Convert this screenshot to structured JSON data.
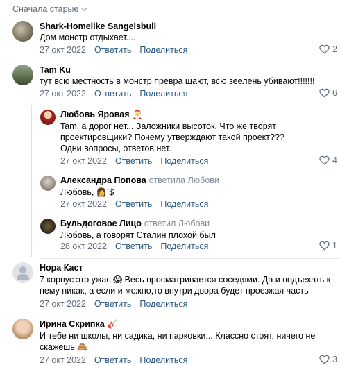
{
  "sort_label": "Сначала старые",
  "comments": [
    {
      "name": "Shark-Homelike Sangelsbull",
      "text": "Дом монстр отдыхает....",
      "date": "27 окт 2022",
      "reply": "Ответить",
      "share": "Поделиться",
      "likes": "2"
    },
    {
      "name": "Tam Ku",
      "text": "тут всю местность в монстр превра щают, всю зеелень убивают!!!!!!!",
      "date": "27 окт 2022",
      "reply": "Ответить",
      "share": "Поделиться",
      "likes": "6",
      "replies": [
        {
          "name": "Любовь Яровая",
          "text": "Tam, а дорог нет... Заложники высоток. Что же творят проектировщики? Почему утверждают такой проект??? Одни вопросы, ответов нет.",
          "date": "27 окт 2022",
          "reply": "Ответить",
          "share": "Поделиться",
          "likes": "4"
        },
        {
          "name": "Александра Попова",
          "replied_to": "ответила Любови",
          "text": "Любовь,",
          "text_suffix": "$",
          "date": "27 окт 2022",
          "reply": "Ответить",
          "share": "Поделиться"
        },
        {
          "name": "Бульдоговое Лицо",
          "replied_to": "ответил Любови",
          "text": "Любовь, а говорят Сталин плохой был",
          "date": "28 окт 2022",
          "reply": "Ответить",
          "share": "Поделиться",
          "likes": "1"
        }
      ]
    },
    {
      "name": "Нора Каст",
      "text": "7 корпус это ужас 😱 Весь просматривается соседями. Да и подъехать к нему никак, а если и можно,то внутри двора будет проезжая часть",
      "date": "27 окт 2022",
      "reply": "Ответить",
      "share": "Поделиться"
    },
    {
      "name": "Ирина Скрипка",
      "text": "И тебе ни школы, ни садика, ни парковки... Классно стоят, ничего не скажешь",
      "date": "27 окт 2022",
      "reply": "Ответить",
      "share": "Поделиться",
      "likes": "3"
    }
  ],
  "colors": {
    "link": "#2a5885",
    "meta": "#626d7a",
    "separator": "#e7e8ec"
  }
}
